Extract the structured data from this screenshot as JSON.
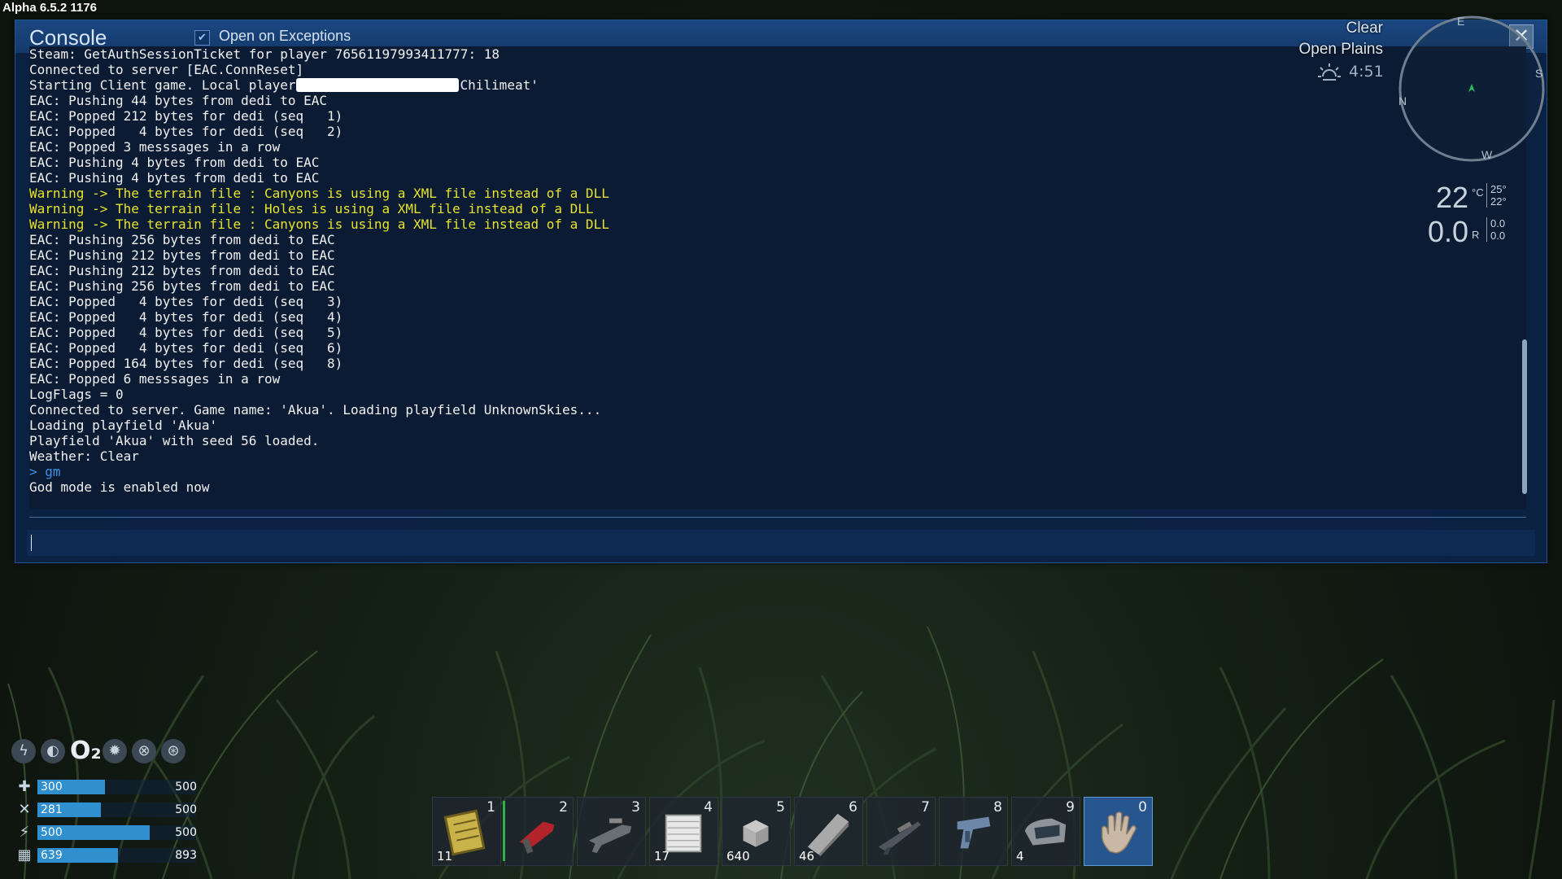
{
  "version": "Alpha 6.5.2 1176",
  "console": {
    "title": "Console",
    "checkbox_label": "Open on Exceptions",
    "checkbox_checked": true,
    "close_glyph": "✕",
    "lines": [
      {
        "text": "Steam: GetAuthSessionTicket for player 76561197993411777: 18",
        "type": "normal"
      },
      {
        "text": "Connected to server [EAC.ConnReset]",
        "type": "normal"
      },
      {
        "pre": "Starting Client game. Local player",
        "post": "Chilimeat'",
        "redacted": true,
        "type": "normal"
      },
      {
        "text": "EAC: Pushing 44 bytes from dedi to EAC",
        "type": "normal"
      },
      {
        "text": "EAC: Popped 212 bytes for dedi (seq   1)",
        "type": "normal"
      },
      {
        "text": "EAC: Popped   4 bytes for dedi (seq   2)",
        "type": "normal"
      },
      {
        "text": "EAC: Popped 3 messsages in a row",
        "type": "normal"
      },
      {
        "text": "EAC: Pushing 4 bytes from dedi to EAC",
        "type": "normal"
      },
      {
        "text": "EAC: Pushing 4 bytes from dedi to EAC",
        "type": "normal"
      },
      {
        "text": "Warning -> The terrain file : Canyons is using a XML file instead of a DLL",
        "type": "warn"
      },
      {
        "text": "Warning -> The terrain file : Holes is using a XML file instead of a DLL",
        "type": "warn"
      },
      {
        "text": "Warning -> The terrain file : Canyons is using a XML file instead of a DLL",
        "type": "warn"
      },
      {
        "text": "EAC: Pushing 256 bytes from dedi to EAC",
        "type": "normal"
      },
      {
        "text": "EAC: Pushing 212 bytes from dedi to EAC",
        "type": "normal"
      },
      {
        "text": "EAC: Pushing 212 bytes from dedi to EAC",
        "type": "normal"
      },
      {
        "text": "EAC: Pushing 256 bytes from dedi to EAC",
        "type": "normal"
      },
      {
        "text": "EAC: Popped   4 bytes for dedi (seq   3)",
        "type": "normal"
      },
      {
        "text": "EAC: Popped   4 bytes for dedi (seq   4)",
        "type": "normal"
      },
      {
        "text": "EAC: Popped   4 bytes for dedi (seq   5)",
        "type": "normal"
      },
      {
        "text": "EAC: Popped   4 bytes for dedi (seq   6)",
        "type": "normal"
      },
      {
        "text": "EAC: Popped 164 bytes for dedi (seq   8)",
        "type": "normal"
      },
      {
        "text": "EAC: Popped 6 messsages in a row",
        "type": "normal"
      },
      {
        "text": "LogFlags = 0",
        "type": "normal"
      },
      {
        "text": "Connected to server. Game name: 'Akua'. Loading playfield UnknownSkies...",
        "type": "normal"
      },
      {
        "text": "Loading playfield 'Akua'",
        "type": "normal"
      },
      {
        "text": "Playfield 'Akua' with seed 56 loaded.",
        "type": "normal"
      },
      {
        "text": "Weather: Clear",
        "type": "normal"
      },
      {
        "text": "> gm",
        "type": "cmd"
      },
      {
        "text": "God mode is enabled now",
        "type": "normal"
      }
    ],
    "input_value": ""
  },
  "hud": {
    "weather": "Clear",
    "biome": "Open Plains",
    "time": "4:51",
    "compass": {
      "e": "E",
      "s": "S",
      "n": "N",
      "w": "W"
    },
    "temperature": "22",
    "temp_unit": "°C",
    "temp_high": "25°",
    "temp_low": "22°",
    "radiation": "0.0",
    "rad_unit": "R",
    "rad_a": "0.0",
    "rad_b": "0.0"
  },
  "stats": [
    {
      "icon": "health-icon",
      "glyph": "✚",
      "value": "300",
      "max": "500",
      "fraction": 0.6
    },
    {
      "icon": "food-icon",
      "glyph": "✕",
      "value": "281",
      "max": "500",
      "fraction": 0.562
    },
    {
      "icon": "stamina-icon",
      "glyph": "⚡",
      "value": "500",
      "max": "500",
      "fraction": 1.0
    },
    {
      "icon": "oxygen-tank-icon",
      "glyph": "▦",
      "value": "639",
      "max": "893",
      "fraction": 0.716
    }
  ],
  "status_icons": [
    "body-temp-icon",
    "helmet-icon",
    "oxygen-icon",
    "radiation-icon",
    "pressure-icon",
    "shield-icon"
  ],
  "status_o2": "O₂",
  "hotbar": [
    {
      "num": "1",
      "count": "11",
      "icon": "data-chip-icon"
    },
    {
      "num": "2",
      "count": "",
      "icon": "red-drill-icon"
    },
    {
      "num": "3",
      "count": "",
      "icon": "rifle-icon"
    },
    {
      "num": "4",
      "count": "17",
      "icon": "plate-icon"
    },
    {
      "num": "5",
      "count": "640",
      "icon": "cube-icon"
    },
    {
      "num": "6",
      "count": "46",
      "icon": "wedge-icon"
    },
    {
      "num": "7",
      "count": "",
      "icon": "sniper-icon"
    },
    {
      "num": "8",
      "count": "",
      "icon": "pistol-icon"
    },
    {
      "num": "9",
      "count": "4",
      "icon": "repair-box-icon"
    },
    {
      "num": "0",
      "count": "",
      "icon": "hand-icon",
      "active": true
    }
  ]
}
